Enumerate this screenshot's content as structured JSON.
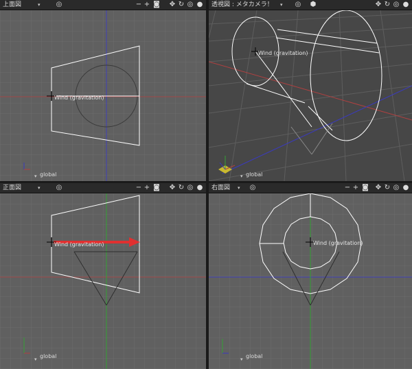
{
  "viewports": {
    "top": {
      "title": "上面図",
      "mode_arrow": "▾",
      "global": "global"
    },
    "persp": {
      "title": "透視図 : メタカメラ！",
      "mode_arrow": "▾",
      "global": "global"
    },
    "front": {
      "title": "正面図",
      "mode_arrow": "▾",
      "global": "global"
    },
    "right": {
      "title": "右面図",
      "mode_arrow": "▾",
      "global": "global"
    }
  },
  "icons": {
    "target": "◎",
    "minus": "−",
    "plus": "+",
    "camera": "◙",
    "move": "✥",
    "rotate": "↻",
    "sphere": "●",
    "cube": "⬢",
    "down": "▾"
  },
  "object_label": "Wind (gravitation)",
  "colors": {
    "bg": "#606060",
    "grid": "#6c6c6c",
    "wire": "#ffffff",
    "axis_red": "#b04040",
    "axis_blue": "#3a3ac0",
    "axis_green": "#35a035",
    "arrow": "#e03030"
  }
}
